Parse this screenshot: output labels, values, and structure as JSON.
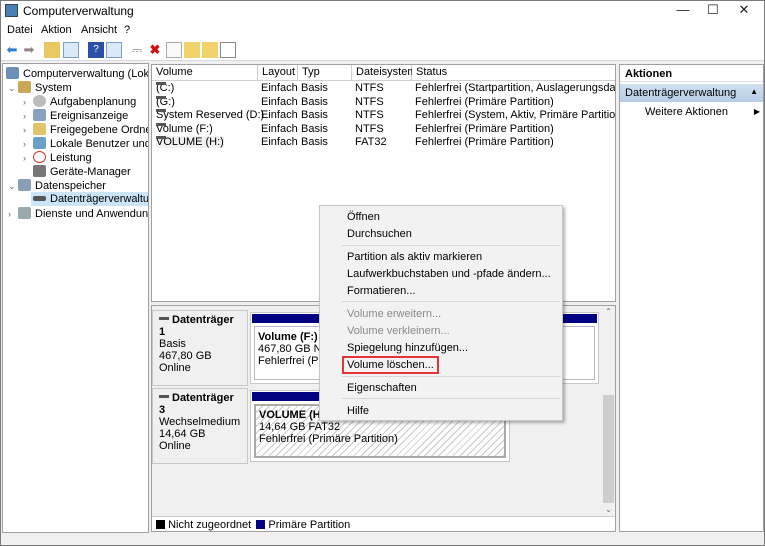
{
  "window": {
    "title": "Computerverwaltung",
    "minimize": "—",
    "maximize": "☐",
    "close": "✕"
  },
  "menubar": [
    "Datei",
    "Aktion",
    "Ansicht",
    "?"
  ],
  "toolbar": [
    "back",
    "forward",
    "up-folder",
    "show-hide-tree",
    "help",
    "show-action-pane",
    "connect",
    "delete",
    "properties",
    "export",
    "find",
    "details"
  ],
  "tree": {
    "root": "Computerverwaltung (Lokal)",
    "system": "System",
    "system_items": [
      "Aufgabenplanung",
      "Ereignisanzeige",
      "Freigegebene Ordner",
      "Lokale Benutzer und Gruppen",
      "Leistung",
      "Geräte-Manager"
    ],
    "storage": "Datenspeicher",
    "storage_items": [
      "Datenträgerverwaltung"
    ],
    "services": "Dienste und Anwendungen"
  },
  "volume_table": {
    "columns": [
      "Volume",
      "Layout",
      "Typ",
      "Dateisystem",
      "Status"
    ],
    "rows": [
      [
        "(C:)",
        "Einfach",
        "Basis",
        "NTFS",
        "Fehlerfrei (Startpartition, Auslagerungsdatei, Abs"
      ],
      [
        "(G:)",
        "Einfach",
        "Basis",
        "NTFS",
        "Fehlerfrei (Primäre Partition)"
      ],
      [
        "System Reserved (D:)",
        "Einfach",
        "Basis",
        "NTFS",
        "Fehlerfrei (System, Aktiv, Primäre Partition)"
      ],
      [
        "Volume (F:)",
        "Einfach",
        "Basis",
        "NTFS",
        "Fehlerfrei (Primäre Partition)"
      ],
      [
        "VOLUME (H:)",
        "Einfach",
        "Basis",
        "FAT32",
        "Fehlerfrei (Primäre Partition)"
      ]
    ]
  },
  "disks": [
    {
      "name": "Datenträger 1",
      "type": "Basis",
      "size": "467,80 GB",
      "state": "Online",
      "partition": {
        "name": "Volume  (F:)",
        "size": "467,80 GB NTFS",
        "status": "Fehlerfrei (Primäre Partition)"
      }
    },
    {
      "name": "Datenträger 3",
      "type": "Wechselmedium",
      "size": "14,64 GB",
      "state": "Online",
      "partition": {
        "name": "VOLUME  (H:)",
        "size": "14,64 GB FAT32",
        "status": "Fehlerfrei (Primäre Partition)"
      }
    }
  ],
  "legend": [
    {
      "label": "Nicht zugeordnet",
      "color": "#000000"
    },
    {
      "label": "Primäre Partition",
      "color": "#000080"
    }
  ],
  "actions": {
    "header": "Aktionen",
    "section": "Datenträgerverwaltung",
    "more": "Weitere Aktionen"
  },
  "context_menu": [
    {
      "label": "Öffnen",
      "enabled": true
    },
    {
      "label": "Durchsuchen",
      "enabled": true
    },
    {
      "label": "Partition als aktiv markieren",
      "enabled": true
    },
    {
      "label": "Laufwerkbuchstaben und -pfade ändern...",
      "enabled": true
    },
    {
      "label": "Formatieren...",
      "enabled": true
    },
    {
      "label": "Volume erweitern...",
      "enabled": false
    },
    {
      "label": "Volume verkleinern...",
      "enabled": false
    },
    {
      "label": "Spiegelung hinzufügen...",
      "enabled": true
    },
    {
      "label": "Volume löschen...",
      "enabled": true,
      "highlighted": true
    },
    {
      "label": "Eigenschaften",
      "enabled": true
    },
    {
      "label": "Hilfe",
      "enabled": true
    }
  ],
  "colors": {
    "highlight": "#e5333a",
    "selection": "#c5d9ee",
    "partition_bar": "#000080"
  }
}
